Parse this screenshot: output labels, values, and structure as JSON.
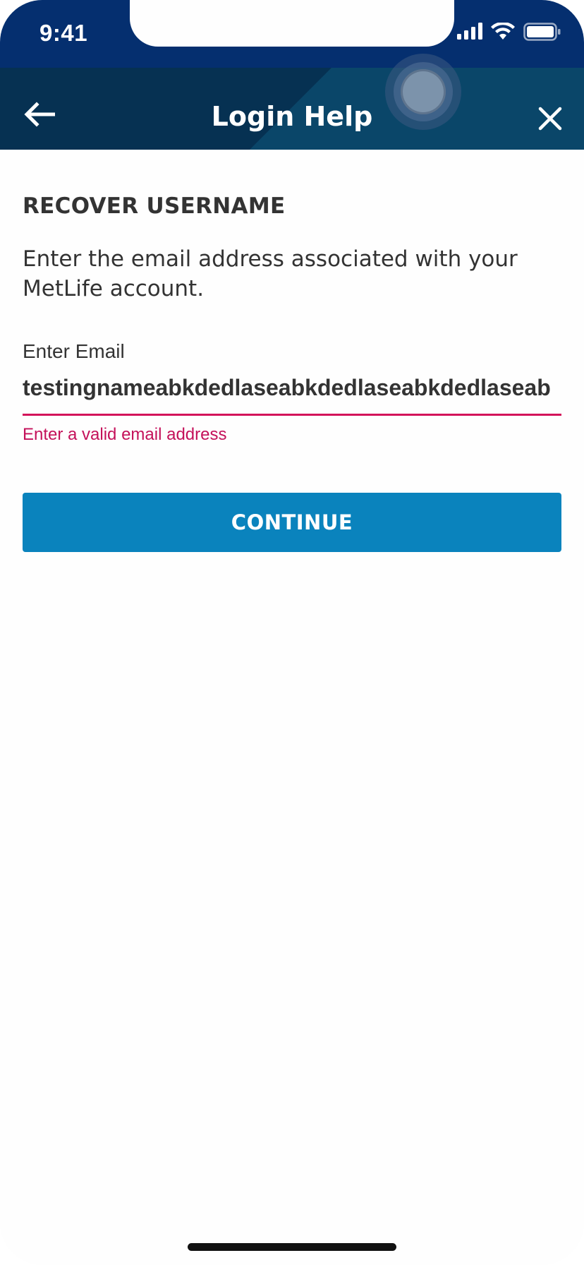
{
  "status_bar": {
    "time": "9:41",
    "icons": [
      "signal-icon",
      "wifi-icon",
      "battery-icon"
    ]
  },
  "nav": {
    "title": "Login Help",
    "back_icon": "arrow-left-icon",
    "close_icon": "close-icon"
  },
  "section": {
    "title": "RECOVER USERNAME",
    "instructions": "Enter the email address associated with your MetLife account."
  },
  "email": {
    "label": "Enter Email",
    "value": "testingnameabkdedlaseabkdedlaseabkdedlaseabkdedlase",
    "error": "Enter a valid email address"
  },
  "continue_button": {
    "label": "CONTINUE"
  },
  "colors": {
    "status_bar": "#052f6f",
    "nav_bar": "#063a5c",
    "error": "#d3135a",
    "button": "#0a83bd",
    "text": "#333333"
  }
}
